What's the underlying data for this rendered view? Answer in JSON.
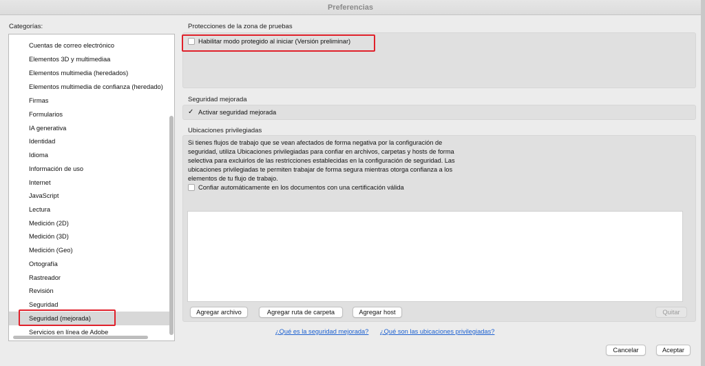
{
  "window": {
    "title": "Preferencias"
  },
  "categories": {
    "label": "Categorías:",
    "items": [
      "Cuentas de correo electrónico",
      "Elementos 3D y multimediaa",
      "Elementos multimedia (heredados)",
      "Elementos multimedia de confianza (heredado)",
      "Firmas",
      "Formularios",
      "IA generativa",
      "Identidad",
      "Idioma",
      "Información de uso",
      "Internet",
      "JavaScript",
      "Lectura",
      "Medición (2D)",
      "Medición (3D)",
      "Medición (Geo)",
      "Ortografía",
      "Rastreador",
      "Revisión",
      "Seguridad",
      "Seguridad (mejorada)",
      "Servicios en línea de Adobe"
    ],
    "selected": "Seguridad (mejorada)"
  },
  "sandbox": {
    "title": "Protecciones de la zona de pruebas",
    "protected_mode_label": "Habilitar modo protegido al iniciar (Versión preliminar)",
    "protected_mode_checked": false
  },
  "enhanced": {
    "title": "Seguridad mejorada",
    "enable_label": "Activar seguridad mejorada",
    "enable_checked": true
  },
  "privileged": {
    "title": "Ubicaciones privilegiadas",
    "description": "Si tienes flujos de trabajo que se vean afectados de forma negativa por la configuración de seguridad, utiliza Ubicaciones privilegiadas para confiar en archivos, carpetas y hosts de forma selectiva para excluirlos de las restricciones establecidas en la configuración de seguridad. Las ubicaciones privilegiadas te permiten trabajar de forma segura mientras otorga confianza a los elementos de tu flujo de trabajo.",
    "trust_cert_label": "Confiar automáticamente en los documentos con una certificación válida",
    "trust_cert_checked": false,
    "add_file": "Agregar archivo",
    "add_folder": "Agregar ruta de carpeta",
    "add_host": "Agregar host",
    "remove": "Quitar"
  },
  "links": {
    "what_is": "¿Qué es la seguridad mejorada?",
    "what_are": "¿Qué son las ubicaciones privilegiadas?"
  },
  "footer": {
    "cancel": "Cancelar",
    "accept": "Aceptar"
  },
  "colors": {
    "highlight": "#e0202a",
    "link": "#1a5fd0",
    "selected_row": "#d8d8d8"
  }
}
